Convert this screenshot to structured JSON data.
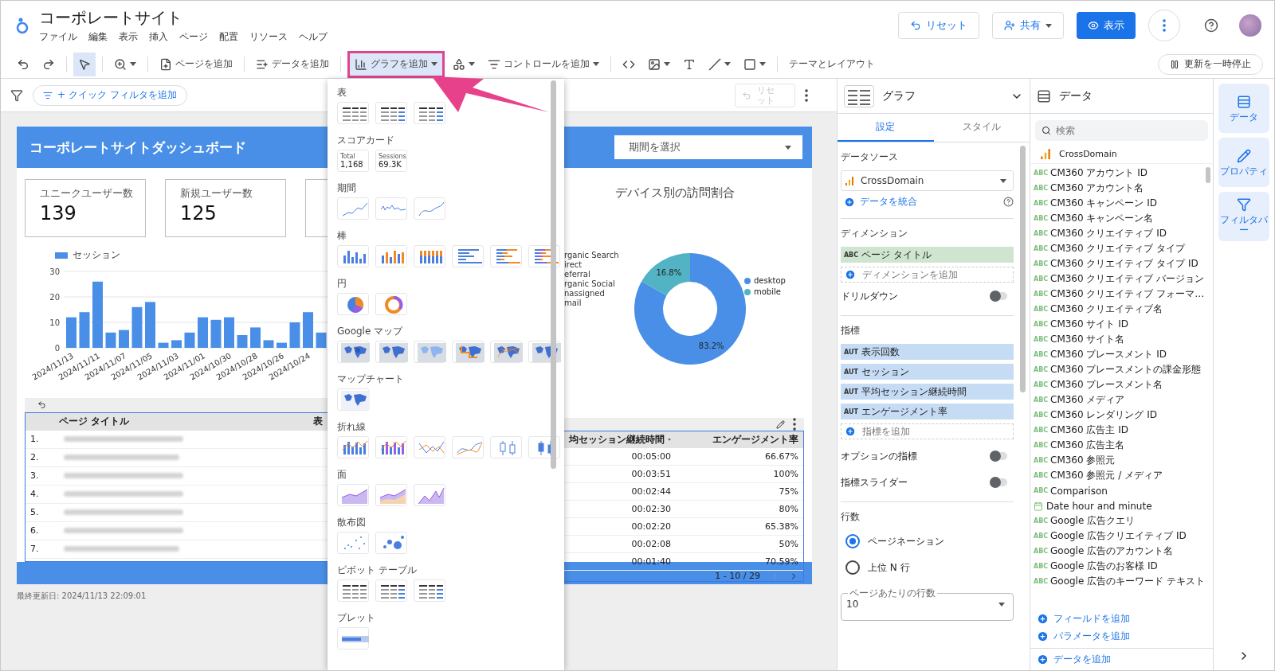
{
  "app": {
    "title": "コーポレートサイト",
    "menus": [
      "ファイル",
      "編集",
      "表示",
      "挿入",
      "ページ",
      "配置",
      "リソース",
      "ヘルプ"
    ],
    "reset": "リセット",
    "share": "共有",
    "view": "表示"
  },
  "toolbar": {
    "items": [
      {
        "kind": "undo",
        "selected": false,
        "highlighted": false
      },
      {
        "kind": "redo",
        "selected": false,
        "highlighted": false
      },
      {
        "kind": "select",
        "selected": true,
        "highlighted": false
      },
      {
        "kind": "zoom",
        "selected": false,
        "highlighted": false
      },
      {
        "kind": "add-page",
        "label": "ページを追加",
        "selected": false,
        "highlighted": false
      },
      {
        "kind": "add-data",
        "label": "データを追加",
        "selected": false,
        "highlighted": false
      },
      {
        "kind": "add-chart",
        "label": "グラフを追加",
        "selected": true,
        "highlighted": true
      },
      {
        "kind": "community",
        "selected": false,
        "highlighted": false
      },
      {
        "kind": "add-control",
        "label": "コントロールを追加",
        "selected": false,
        "highlighted": false
      },
      {
        "kind": "code",
        "selected": false,
        "highlighted": false
      },
      {
        "kind": "image",
        "selected": false,
        "highlighted": false
      },
      {
        "kind": "text",
        "selected": false,
        "highlighted": false
      },
      {
        "kind": "line",
        "selected": false,
        "highlighted": false
      },
      {
        "kind": "shape",
        "selected": false,
        "highlighted": false
      },
      {
        "kind": "theme",
        "label": "テーマとレイアウト",
        "selected": false,
        "highlighted": false
      }
    ],
    "pause": "更新を一時停止"
  },
  "filter_bar": {
    "quick_filter": "+ クイック フィルタを追加",
    "reset": "リセット",
    "reset_disabled": true
  },
  "report": {
    "title": "コーポレートサイトダッシュボード",
    "date_picker": "期間を選択",
    "scorecards": [
      {
        "kind": "metric",
        "label": "ユニークユーザー数",
        "value": "139"
      },
      {
        "kind": "metric",
        "label": "新規ユーザー数",
        "value": "125"
      },
      {
        "kind": "covered"
      }
    ],
    "bar_chart": {
      "chart_data": {
        "type": "bar",
        "series": [
          {
            "name": "セッション",
            "color": "#4a8fe7",
            "values": [
              12,
              14,
              26,
              6,
              7,
              16,
              18,
              2,
              3,
              6,
              12,
              11,
              12,
              5,
              8,
              3,
              2,
              10,
              14,
              6
            ]
          }
        ],
        "categories": [
          "2024/11/13",
          null,
          "2024/11/11",
          null,
          "2024/11/07",
          null,
          "2024/11/05",
          null,
          "2024/11/03",
          null,
          "2024/11/01",
          null,
          "2024/10/30",
          null,
          "2024/10/28",
          null,
          "2024/10/26",
          null,
          "2024/10/24",
          null
        ],
        "ylim": [
          0,
          30
        ],
        "yticks": [
          0,
          10,
          20,
          30
        ]
      }
    },
    "covered_legend": [
      "rganic Search",
      "irect",
      "eferral",
      "rganic Social",
      "nassigned",
      "mail"
    ],
    "donut": {
      "slices": [
        {
          "color": "#4a8fe7"
        },
        {
          "color": "#52b3c4"
        }
      ],
      "chart_data": {
        "type": "donut",
        "title": "デバイス別の訪問割合",
        "categories": [
          "desktop",
          "mobile"
        ],
        "values": [
          83.2,
          16.8
        ],
        "value_labels": [
          "83.2%",
          "16.8%"
        ]
      }
    },
    "table": {
      "columns": [
        {
          "label": "ページ タイトル",
          "sorted": false
        },
        {
          "label": "表",
          "sorted": false
        },
        {
          "label": "均セッション継続時間",
          "sorted": true
        },
        {
          "label": "エンゲージメント率",
          "sorted": false
        }
      ],
      "rows": [
        {
          "index": "1.",
          "duration": "00:05:00",
          "rate": "66.67%"
        },
        {
          "index": "2.",
          "duration": "00:03:51",
          "rate": "100%"
        },
        {
          "index": "3.",
          "duration": "00:02:44",
          "rate": "75%"
        },
        {
          "index": "4.",
          "duration": "00:02:30",
          "rate": "80%"
        },
        {
          "index": "5.",
          "duration": "00:02:20",
          "rate": "65.38%"
        },
        {
          "index": "6.",
          "duration": "00:02:08",
          "rate": "50%"
        },
        {
          "index": "7.",
          "duration": "00:01:40",
          "rate": "70.59%"
        }
      ],
      "pagination": "1 - 10 / 29"
    },
    "updated": "最終更新日: 2024/11/13 22:09:01"
  },
  "chart_menu": {
    "sections": [
      {
        "title": "表",
        "items": [
          {
            "kind": "table"
          },
          {
            "kind": "table-bar"
          },
          {
            "kind": "table-heat"
          }
        ]
      },
      {
        "title": "スコアカード",
        "items": [
          {
            "kind": "scorecard",
            "caption": "Total",
            "value": "1,168"
          },
          {
            "kind": "scorecard",
            "caption": "Sessions",
            "value": "69.3K"
          }
        ]
      },
      {
        "title": "期間",
        "items": [
          {
            "kind": "line"
          },
          {
            "kind": "sparkline"
          },
          {
            "kind": "curve"
          }
        ]
      },
      {
        "title": "棒",
        "items": [
          {
            "kind": "column"
          },
          {
            "kind": "column-grouped"
          },
          {
            "kind": "column-stacked"
          },
          {
            "kind": "bar"
          },
          {
            "kind": "bar-grouped"
          },
          {
            "kind": "bar-stacked"
          }
        ]
      },
      {
        "title": "円",
        "items": [
          {
            "kind": "pie"
          },
          {
            "kind": "donut"
          }
        ]
      },
      {
        "title": "Google マップ",
        "items": [
          {
            "kind": "map-bubble"
          },
          {
            "kind": "map-filled"
          },
          {
            "kind": "map-heat"
          },
          {
            "kind": "map-lines"
          },
          {
            "kind": "map-routes"
          },
          {
            "kind": "map-filled"
          }
        ]
      },
      {
        "title": "マップチャート",
        "items": [
          {
            "kind": "map-geo"
          }
        ]
      },
      {
        "title": "折れ線",
        "items": [
          {
            "kind": "combo"
          },
          {
            "kind": "combo-stacked"
          },
          {
            "kind": "line-multi"
          },
          {
            "kind": "curve-multi"
          },
          {
            "kind": "candlestick"
          },
          {
            "kind": "candlestick-filled"
          }
        ]
      },
      {
        "title": "面",
        "items": [
          {
            "kind": "area"
          },
          {
            "kind": "area-stacked"
          },
          {
            "kind": "area-peaks"
          }
        ]
      },
      {
        "title": "散布図",
        "items": [
          {
            "kind": "scatter"
          },
          {
            "kind": "bubble"
          }
        ]
      },
      {
        "title": "ピボット テーブル",
        "items": [
          {
            "kind": "pivot"
          },
          {
            "kind": "pivot-bar"
          },
          {
            "kind": "pivot-heat"
          }
        ]
      },
      {
        "title": "ブレット",
        "items": [
          {
            "kind": "bullet"
          }
        ]
      }
    ]
  },
  "graph_panel": {
    "title": "グラフ",
    "tabs": [
      {
        "label": "設定",
        "selected": true
      },
      {
        "label": "スタイル",
        "selected": false
      }
    ],
    "data_source": {
      "label": "データソース",
      "value": "CrossDomain",
      "blend": "データを統合"
    },
    "dimension": {
      "label": "ディメンション",
      "chips": [
        {
          "type": "ABC",
          "name": "ページ タイトル"
        }
      ],
      "add": "ディメンションを追加",
      "drilldown": {
        "label": "ドリルダウン",
        "on": false
      }
    },
    "metrics": {
      "label": "指標",
      "chips": [
        {
          "type": "AUT",
          "name": "表示回数"
        },
        {
          "type": "AUT",
          "name": "セッション"
        },
        {
          "type": "AUT",
          "name": "平均セッション継続時間"
        },
        {
          "type": "AUT",
          "name": "エンゲージメント率"
        }
      ],
      "add": "指標を追加",
      "toggles": [
        {
          "label": "オプションの指標",
          "on": false
        },
        {
          "label": "指標スライダー",
          "on": false
        }
      ]
    },
    "rows": {
      "label": "行数",
      "options": [
        {
          "label": "ページネーション",
          "selected": true
        },
        {
          "label": "上位 N 行",
          "selected": false
        }
      ],
      "per_page": {
        "label": "ページあたりの行数",
        "value": "10"
      }
    }
  },
  "data_panel": {
    "title": "データ",
    "search_placeholder": "検索",
    "source": "CrossDomain",
    "fields": [
      {
        "kind": "text",
        "type": "ABC",
        "name": "CM360 アカウント ID"
      },
      {
        "kind": "text",
        "type": "ABC",
        "name": "CM360 アカウント名"
      },
      {
        "kind": "text",
        "type": "ABC",
        "name": "CM360 キャンペーン ID"
      },
      {
        "kind": "text",
        "type": "ABC",
        "name": "CM360 キャンペーン名"
      },
      {
        "kind": "text",
        "type": "ABC",
        "name": "CM360 クリエイティブ ID"
      },
      {
        "kind": "text",
        "type": "ABC",
        "name": "CM360 クリエイティブ タイプ"
      },
      {
        "kind": "text",
        "type": "ABC",
        "name": "CM360 クリエイティブ タイプ ID"
      },
      {
        "kind": "text",
        "type": "ABC",
        "name": "CM360 クリエイティブ バージョン"
      },
      {
        "kind": "text",
        "type": "ABC",
        "name": "CM360 クリエイティブ フォーマ…"
      },
      {
        "kind": "text",
        "type": "ABC",
        "name": "CM360 クリエイティブ名"
      },
      {
        "kind": "text",
        "type": "ABC",
        "name": "CM360 サイト ID"
      },
      {
        "kind": "text",
        "type": "ABC",
        "name": "CM360 サイト名"
      },
      {
        "kind": "text",
        "type": "ABC",
        "name": "CM360 プレースメント ID"
      },
      {
        "kind": "text",
        "type": "ABC",
        "name": "CM360 プレースメントの課金形態"
      },
      {
        "kind": "text",
        "type": "ABC",
        "name": "CM360 プレースメント名"
      },
      {
        "kind": "text",
        "type": "ABC",
        "name": "CM360 メディア"
      },
      {
        "kind": "text",
        "type": "ABC",
        "name": "CM360 レンダリング ID"
      },
      {
        "kind": "text",
        "type": "ABC",
        "name": "CM360 広告主 ID"
      },
      {
        "kind": "text",
        "type": "ABC",
        "name": "CM360 広告主名"
      },
      {
        "kind": "text",
        "type": "ABC",
        "name": "CM360 参照元"
      },
      {
        "kind": "text",
        "type": "ABC",
        "name": "CM360 参照元 / メディア"
      },
      {
        "kind": "text",
        "type": "ABC",
        "name": "Comparison"
      },
      {
        "kind": "date",
        "name": "Date hour and minute"
      },
      {
        "kind": "text",
        "type": "ABC",
        "name": "Google 広告クエリ"
      },
      {
        "kind": "text",
        "type": "ABC",
        "name": "Google 広告クリエイティブ ID"
      },
      {
        "kind": "text",
        "type": "ABC",
        "name": "Google 広告のアカウント名"
      },
      {
        "kind": "text",
        "type": "ABC",
        "name": "Google 広告のお客様 ID"
      },
      {
        "kind": "text",
        "type": "ABC",
        "name": "Google 広告のキーワード テキスト"
      }
    ],
    "actions": [
      "フィールドを追加",
      "パラメータを追加"
    ],
    "add_data": "データを追加"
  },
  "rail": [
    {
      "kind": "data",
      "label": "データ"
    },
    {
      "kind": "properties",
      "label": "プロパティ"
    },
    {
      "kind": "filter",
      "label": "フィルタバー"
    }
  ]
}
